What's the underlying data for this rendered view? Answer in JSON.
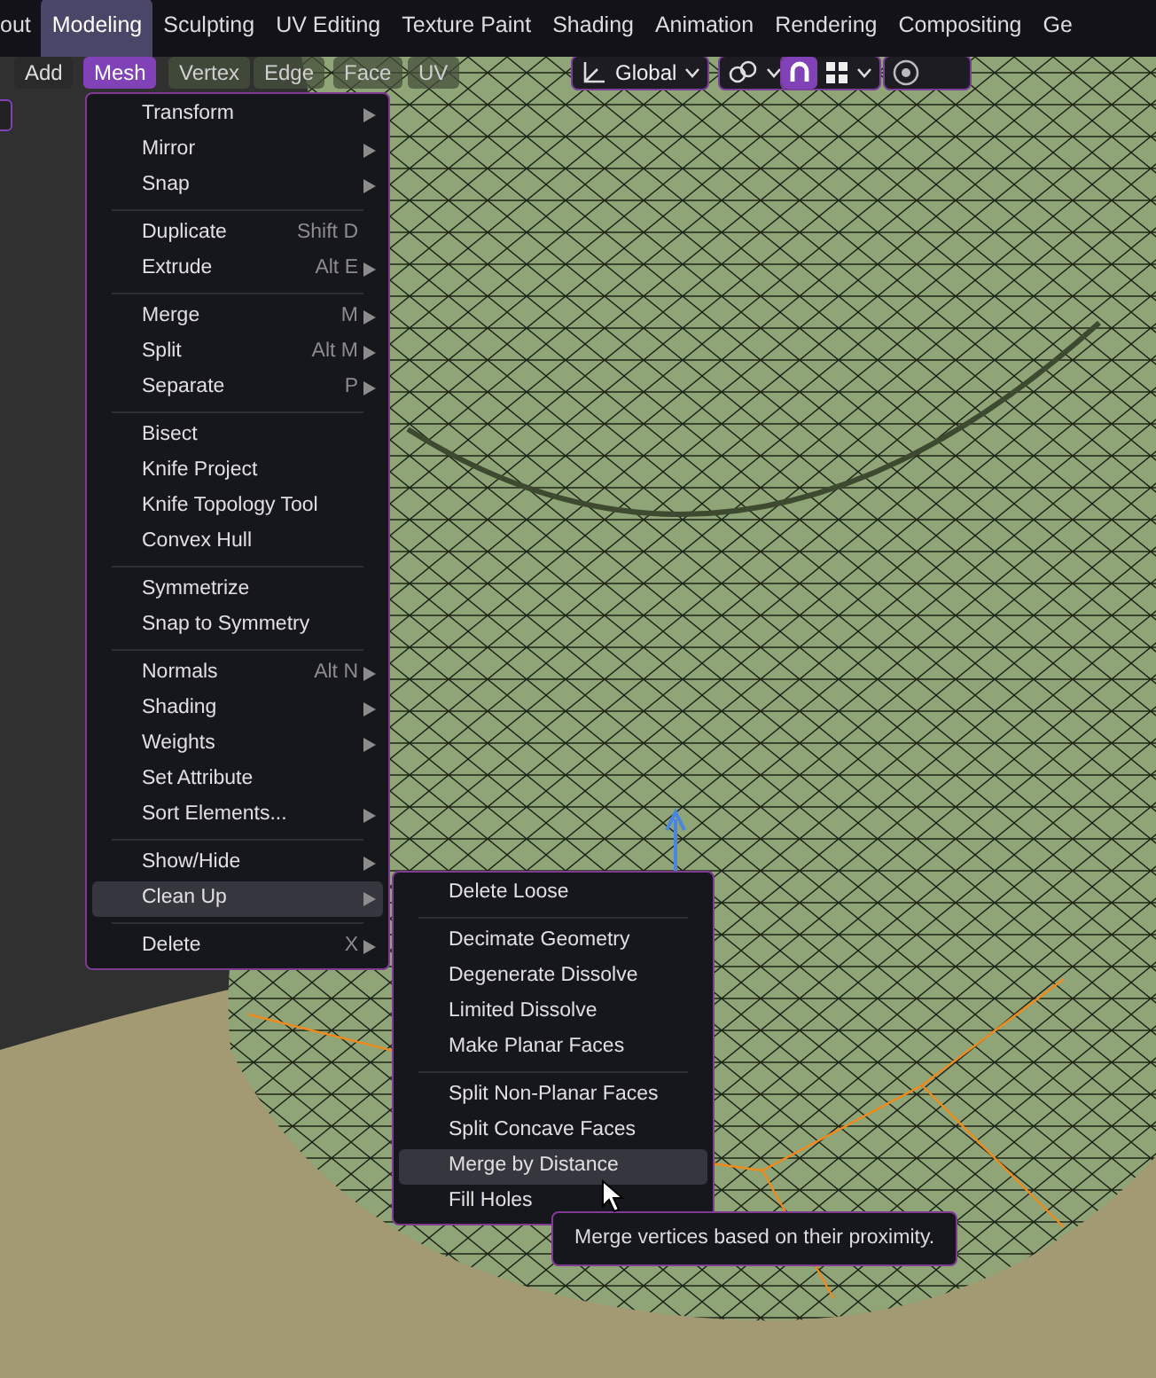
{
  "workspace_tabs": [
    {
      "label": "out",
      "selected": false
    },
    {
      "label": "Modeling",
      "selected": true
    },
    {
      "label": "Sculpting",
      "selected": false
    },
    {
      "label": "UV Editing",
      "selected": false
    },
    {
      "label": "Texture Paint",
      "selected": false
    },
    {
      "label": "Shading",
      "selected": false
    },
    {
      "label": "Animation",
      "selected": false
    },
    {
      "label": "Rendering",
      "selected": false
    },
    {
      "label": "Compositing",
      "selected": false
    },
    {
      "label": "Ge",
      "selected": false
    }
  ],
  "header": {
    "menus": [
      {
        "label": "Add",
        "selected": false,
        "dimmed": false
      },
      {
        "label": "Mesh",
        "selected": true,
        "dimmed": false
      },
      {
        "label": "Vertex",
        "selected": false,
        "dimmed": true
      },
      {
        "label": "Edge",
        "selected": false,
        "dimmed": true
      },
      {
        "label": "Face",
        "selected": false,
        "dimmed": true
      },
      {
        "label": "UV",
        "selected": false,
        "dimmed": true
      }
    ],
    "orientation": "Global",
    "proportional_editing_on": false
  },
  "mesh_menu": {
    "groups": [
      [
        {
          "label": "Transform",
          "submenu": true,
          "highlighted": false
        },
        {
          "label": "Mirror",
          "submenu": true,
          "highlighted": false
        },
        {
          "label": "Snap",
          "submenu": true,
          "highlighted": false
        }
      ],
      [
        {
          "label": "Duplicate",
          "shortcut": "Shift D",
          "submenu": false,
          "highlighted": false
        },
        {
          "label": "Extrude",
          "shortcut": "Alt E",
          "submenu": true,
          "highlighted": false
        }
      ],
      [
        {
          "label": "Merge",
          "shortcut": "M",
          "submenu": true,
          "highlighted": false
        },
        {
          "label": "Split",
          "shortcut": "Alt M",
          "submenu": true,
          "highlighted": false
        },
        {
          "label": "Separate",
          "shortcut": "P",
          "submenu": true,
          "highlighted": false
        }
      ],
      [
        {
          "label": "Bisect",
          "submenu": false,
          "highlighted": false
        },
        {
          "label": "Knife Project",
          "submenu": false,
          "highlighted": false
        },
        {
          "label": "Knife Topology Tool",
          "submenu": false,
          "highlighted": false
        },
        {
          "label": "Convex Hull",
          "submenu": false,
          "highlighted": false
        }
      ],
      [
        {
          "label": "Symmetrize",
          "submenu": false,
          "highlighted": false
        },
        {
          "label": "Snap to Symmetry",
          "submenu": false,
          "highlighted": false
        }
      ],
      [
        {
          "label": "Normals",
          "shortcut": "Alt N",
          "submenu": true,
          "highlighted": false
        },
        {
          "label": "Shading",
          "submenu": true,
          "highlighted": false
        },
        {
          "label": "Weights",
          "submenu": true,
          "highlighted": false
        },
        {
          "label": "Set Attribute",
          "submenu": false,
          "highlighted": false
        },
        {
          "label": "Sort Elements...",
          "submenu": true,
          "highlighted": false
        }
      ],
      [
        {
          "label": "Show/Hide",
          "submenu": true,
          "highlighted": false
        },
        {
          "label": "Clean Up",
          "submenu": true,
          "highlighted": true
        }
      ],
      [
        {
          "label": "Delete",
          "shortcut": "X",
          "submenu": true,
          "highlighted": false
        }
      ]
    ]
  },
  "cleanup_menu": {
    "groups": [
      [
        {
          "label": "Delete Loose",
          "submenu": false,
          "highlighted": false
        }
      ],
      [
        {
          "label": "Decimate Geometry",
          "submenu": false,
          "highlighted": false
        },
        {
          "label": "Degenerate Dissolve",
          "submenu": false,
          "highlighted": false
        },
        {
          "label": "Limited Dissolve",
          "submenu": false,
          "highlighted": false
        },
        {
          "label": "Make Planar Faces",
          "submenu": false,
          "highlighted": false
        }
      ],
      [
        {
          "label": "Split Non-Planar Faces",
          "submenu": false,
          "highlighted": false
        },
        {
          "label": "Split Concave Faces",
          "submenu": false,
          "highlighted": false
        },
        {
          "label": "Merge by Distance",
          "submenu": false,
          "highlighted": true
        },
        {
          "label": "Fill Holes",
          "submenu": false,
          "highlighted": false
        }
      ]
    ]
  },
  "tooltip": "Merge vertices based on their proximity."
}
